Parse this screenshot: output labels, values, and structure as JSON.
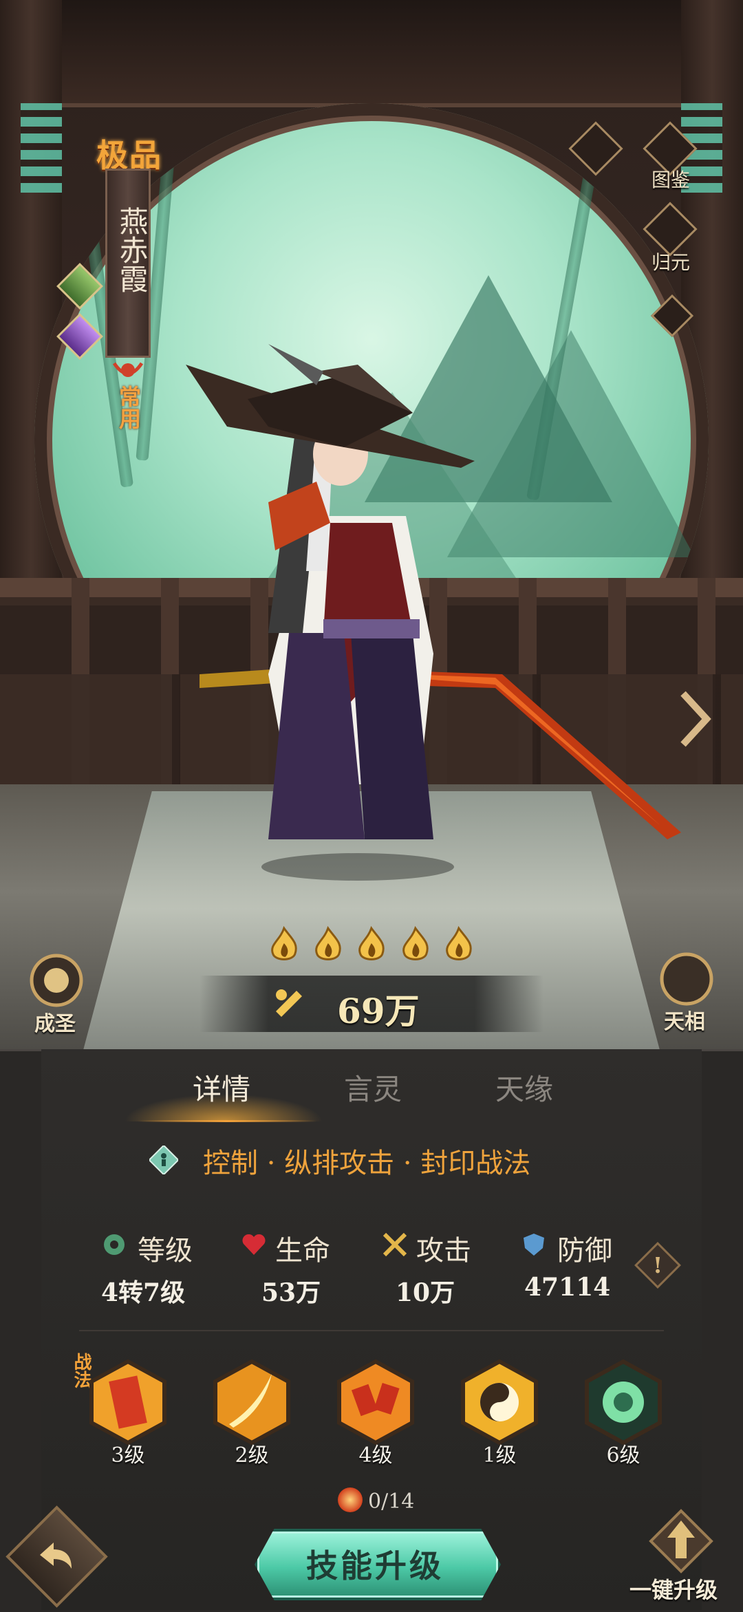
{
  "hero": {
    "rarity": "极品",
    "name": "燕赤霞",
    "common_tag": "常用"
  },
  "right_menu": {
    "illustrated": "图鉴",
    "return": "归元"
  },
  "power": {
    "stars": 5,
    "value": "69万"
  },
  "corners": {
    "left": "成圣",
    "right": "天相"
  },
  "tabs": [
    {
      "label": "详情",
      "active": true
    },
    {
      "label": "言灵",
      "active": false
    },
    {
      "label": "天缘",
      "active": false
    }
  ],
  "role": "控制 · 纵排攻击 · 封印战法",
  "stats": [
    {
      "label": "等级",
      "value": "4转7级",
      "icon": "level-icon"
    },
    {
      "label": "生命",
      "value": "53万",
      "icon": "heart-icon"
    },
    {
      "label": "攻击",
      "value": "10万",
      "icon": "swords-icon"
    },
    {
      "label": "防御",
      "value": "47114",
      "icon": "shield-icon"
    }
  ],
  "skills_tag": "战法",
  "skills": [
    {
      "level": "3级",
      "icon": "talisman-icon"
    },
    {
      "level": "2级",
      "icon": "blade-icon"
    },
    {
      "level": "4级",
      "icon": "cards-icon"
    },
    {
      "level": "1级",
      "icon": "yinyang-icon"
    },
    {
      "level": "6级",
      "icon": "seal-icon"
    }
  ],
  "skill_scroll": "0/14",
  "buttons": {
    "upgrade": "技能升级",
    "one_key": "一键升级",
    "info": "!"
  },
  "colors": {
    "accent": "#f3a23a",
    "jade": "#4cc9a6",
    "panel": "#2a2826"
  }
}
